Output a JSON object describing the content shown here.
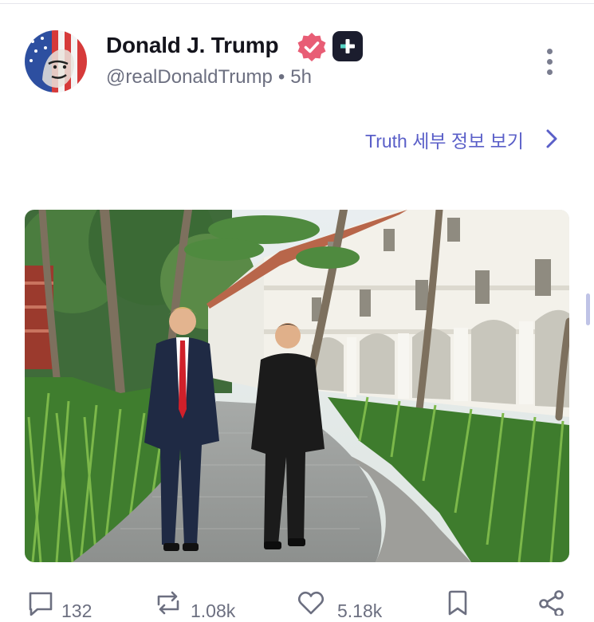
{
  "post": {
    "author": {
      "name": "Donald J. Trump",
      "handle": "@realDonaldTrump",
      "time": "5h"
    },
    "details_link": "Truth 세부 정보 보기",
    "stats": {
      "replies": "132",
      "retruths": "1.08k",
      "likes": "5.18k"
    }
  },
  "icons": {
    "verified": "verified-badge-icon",
    "plus": "truth-plus-icon",
    "more": "more-vertical-icon",
    "chevron": "chevron-right-icon",
    "reply": "reply-icon",
    "retruth": "retruth-icon",
    "like": "heart-icon",
    "bookmark": "bookmark-icon",
    "share": "share-icon"
  },
  "colors": {
    "accent": "#5a5fc8",
    "verified": "#e85d75",
    "muted": "#6c6f80"
  }
}
